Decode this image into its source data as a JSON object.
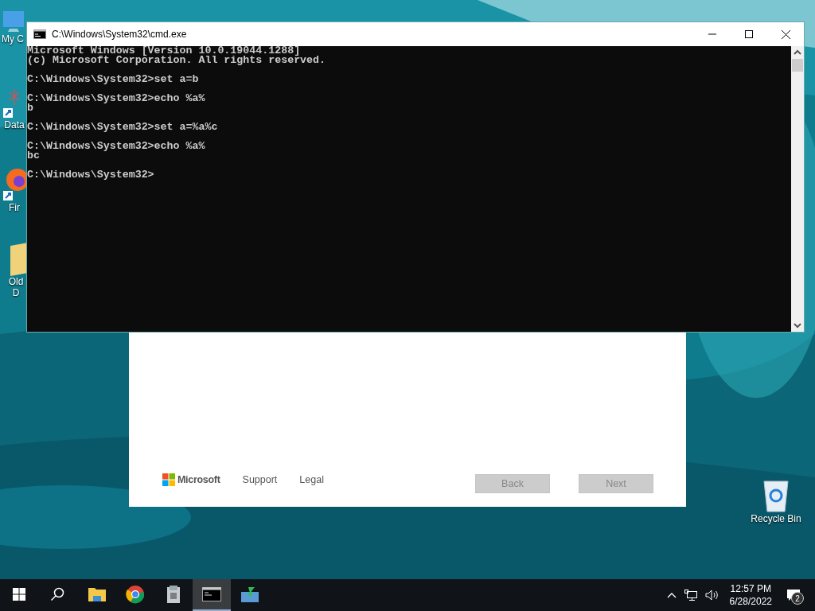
{
  "desktop_icons": [
    {
      "kind": "computer",
      "label": "My C"
    },
    {
      "kind": "shortcut",
      "label": "Data"
    },
    {
      "kind": "browser",
      "label": "Fir"
    },
    {
      "kind": "folder",
      "label": "Old",
      "label_2": "D"
    }
  ],
  "recycle_bin": {
    "label": "Recycle Bin"
  },
  "setup_dialog": {
    "logo_text": "Microsoft",
    "links": [
      "Support",
      "Legal"
    ],
    "buttons": [
      {
        "label": "Back",
        "disabled": true
      },
      {
        "label": "Next",
        "disabled": true
      }
    ]
  },
  "cmd_window": {
    "title": "C:\\Windows\\System32\\cmd.exe",
    "blocks": [
      [
        "Microsoft Windows [Version 10.0.19044.1288]",
        "(c) Microsoft Corporation. All rights reserved."
      ],
      [
        "C:\\Windows\\System32>set a=b"
      ],
      [
        "C:\\Windows\\System32>echo %a%",
        "b"
      ],
      [
        "C:\\Windows\\System32>set a=%a%c"
      ],
      [
        "C:\\Windows\\System32>echo %a%",
        "bc"
      ],
      [
        "C:\\Windows\\System32>"
      ]
    ]
  },
  "taskbar": {
    "apps": [
      {
        "kind": "start",
        "active": false
      },
      {
        "kind": "search",
        "active": false
      },
      {
        "kind": "folder",
        "active": false
      },
      {
        "kind": "browser",
        "active": false
      },
      {
        "kind": "archive",
        "active": false
      },
      {
        "kind": "terminal",
        "active": true
      },
      {
        "kind": "installer",
        "active": false
      }
    ],
    "time": "12:57 PM",
    "date": "6/28/2022",
    "notification_count": "2"
  }
}
